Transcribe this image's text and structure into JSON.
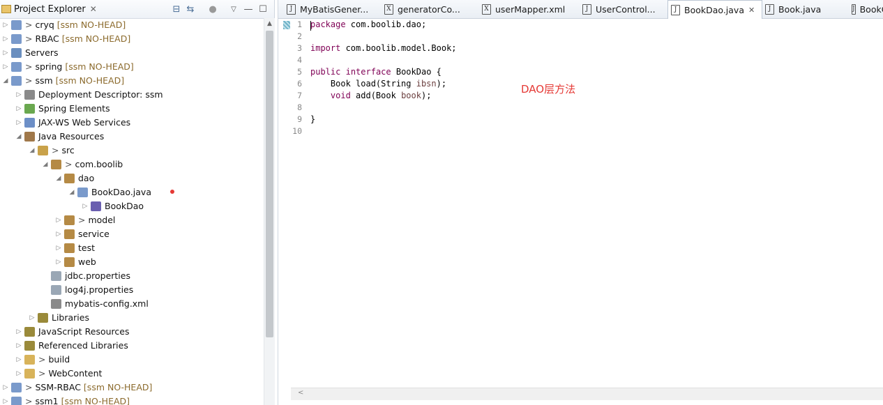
{
  "explorer": {
    "title": "Project Explorer",
    "close": "✕",
    "tree": [
      {
        "prefix": "> ",
        "label": "cryq",
        "scm": "[ssm NO-HEAD]",
        "expanded": false
      },
      {
        "prefix": "> ",
        "label": "RBAC",
        "scm": "[ssm NO-HEAD]",
        "expanded": false
      },
      {
        "prefix": "",
        "label": "Servers",
        "scm": "",
        "expanded": false
      },
      {
        "prefix": "> ",
        "label": "spring",
        "scm": "[ssm NO-HEAD]",
        "expanded": false
      },
      {
        "prefix": "> ",
        "label": "ssm",
        "scm": "[ssm NO-HEAD]",
        "expanded": true
      },
      {
        "prefix": "",
        "label": "Deployment Descriptor: ssm",
        "scm": "",
        "expanded": false
      },
      {
        "prefix": "",
        "label": "Spring Elements",
        "scm": "",
        "expanded": false
      },
      {
        "prefix": "",
        "label": "JAX-WS Web Services",
        "scm": "",
        "expanded": false
      },
      {
        "prefix": "",
        "label": "Java Resources",
        "scm": "",
        "expanded": true
      },
      {
        "prefix": "> ",
        "label": "src",
        "scm": "",
        "expanded": true
      },
      {
        "prefix": "> ",
        "label": "com.boolib",
        "scm": "",
        "expanded": true
      },
      {
        "prefix": "",
        "label": "dao",
        "scm": "",
        "expanded": true
      },
      {
        "prefix": "",
        "label": "BookDao.java",
        "scm": "",
        "expanded": true
      },
      {
        "prefix": "",
        "label": "BookDao",
        "scm": "",
        "expanded": false
      },
      {
        "prefix": "> ",
        "label": "model",
        "scm": "",
        "expanded": false
      },
      {
        "prefix": "",
        "label": "service",
        "scm": "",
        "expanded": false
      },
      {
        "prefix": "",
        "label": "test",
        "scm": "",
        "expanded": false
      },
      {
        "prefix": "",
        "label": "web",
        "scm": "",
        "expanded": false
      },
      {
        "prefix": "",
        "label": "jdbc.properties",
        "scm": "",
        "expanded": false
      },
      {
        "prefix": "",
        "label": "log4j.properties",
        "scm": "",
        "expanded": false
      },
      {
        "prefix": "",
        "label": "mybatis-config.xml",
        "scm": "",
        "expanded": false
      },
      {
        "prefix": "",
        "label": "Libraries",
        "scm": "",
        "expanded": false
      },
      {
        "prefix": "",
        "label": "JavaScript Resources",
        "scm": "",
        "expanded": false
      },
      {
        "prefix": "",
        "label": "Referenced Libraries",
        "scm": "",
        "expanded": false
      },
      {
        "prefix": "> ",
        "label": "build",
        "scm": "",
        "expanded": false
      },
      {
        "prefix": "> ",
        "label": "WebContent",
        "scm": "",
        "expanded": false
      },
      {
        "prefix": "> ",
        "label": "SSM-RBAC",
        "scm": "[ssm NO-HEAD]",
        "expanded": false
      },
      {
        "prefix": "> ",
        "label": "ssm1",
        "scm": "[ssm NO-HEAD]",
        "expanded": false
      }
    ]
  },
  "editor": {
    "tabs": [
      {
        "label": "MyBatisGener...",
        "icon": "J"
      },
      {
        "label": "generatorCo...",
        "icon": "X"
      },
      {
        "label": "userMapper.xml",
        "icon": "X"
      },
      {
        "label": "UserControl...",
        "icon": "J"
      },
      {
        "label": "BookDao.java",
        "icon": "J",
        "active": true
      },
      {
        "label": "Book.java",
        "icon": "J"
      },
      {
        "label": "BookCon",
        "icon": "J"
      }
    ],
    "line_numbers": [
      "1",
      "2",
      "3",
      "4",
      "5",
      "6",
      "7",
      "8",
      "9",
      "10"
    ],
    "code": {
      "l1_kw": "package",
      "l1_rest": " com.boolib.dao;",
      "l3_kw": "import",
      "l3_rest": " com.boolib.model.Book;",
      "l5_kw1": "public",
      "l5_kw2": "interface",
      "l5_rest": " BookDao {",
      "l6_a": "    Book load(String ",
      "l6_param": "ibsn",
      "l6_b": ");",
      "l7_kw": "void",
      "l7_a": " add(Book ",
      "l7_param": "book",
      "l7_b": ");",
      "l9": "}"
    },
    "annotation": "DAO层方法"
  }
}
